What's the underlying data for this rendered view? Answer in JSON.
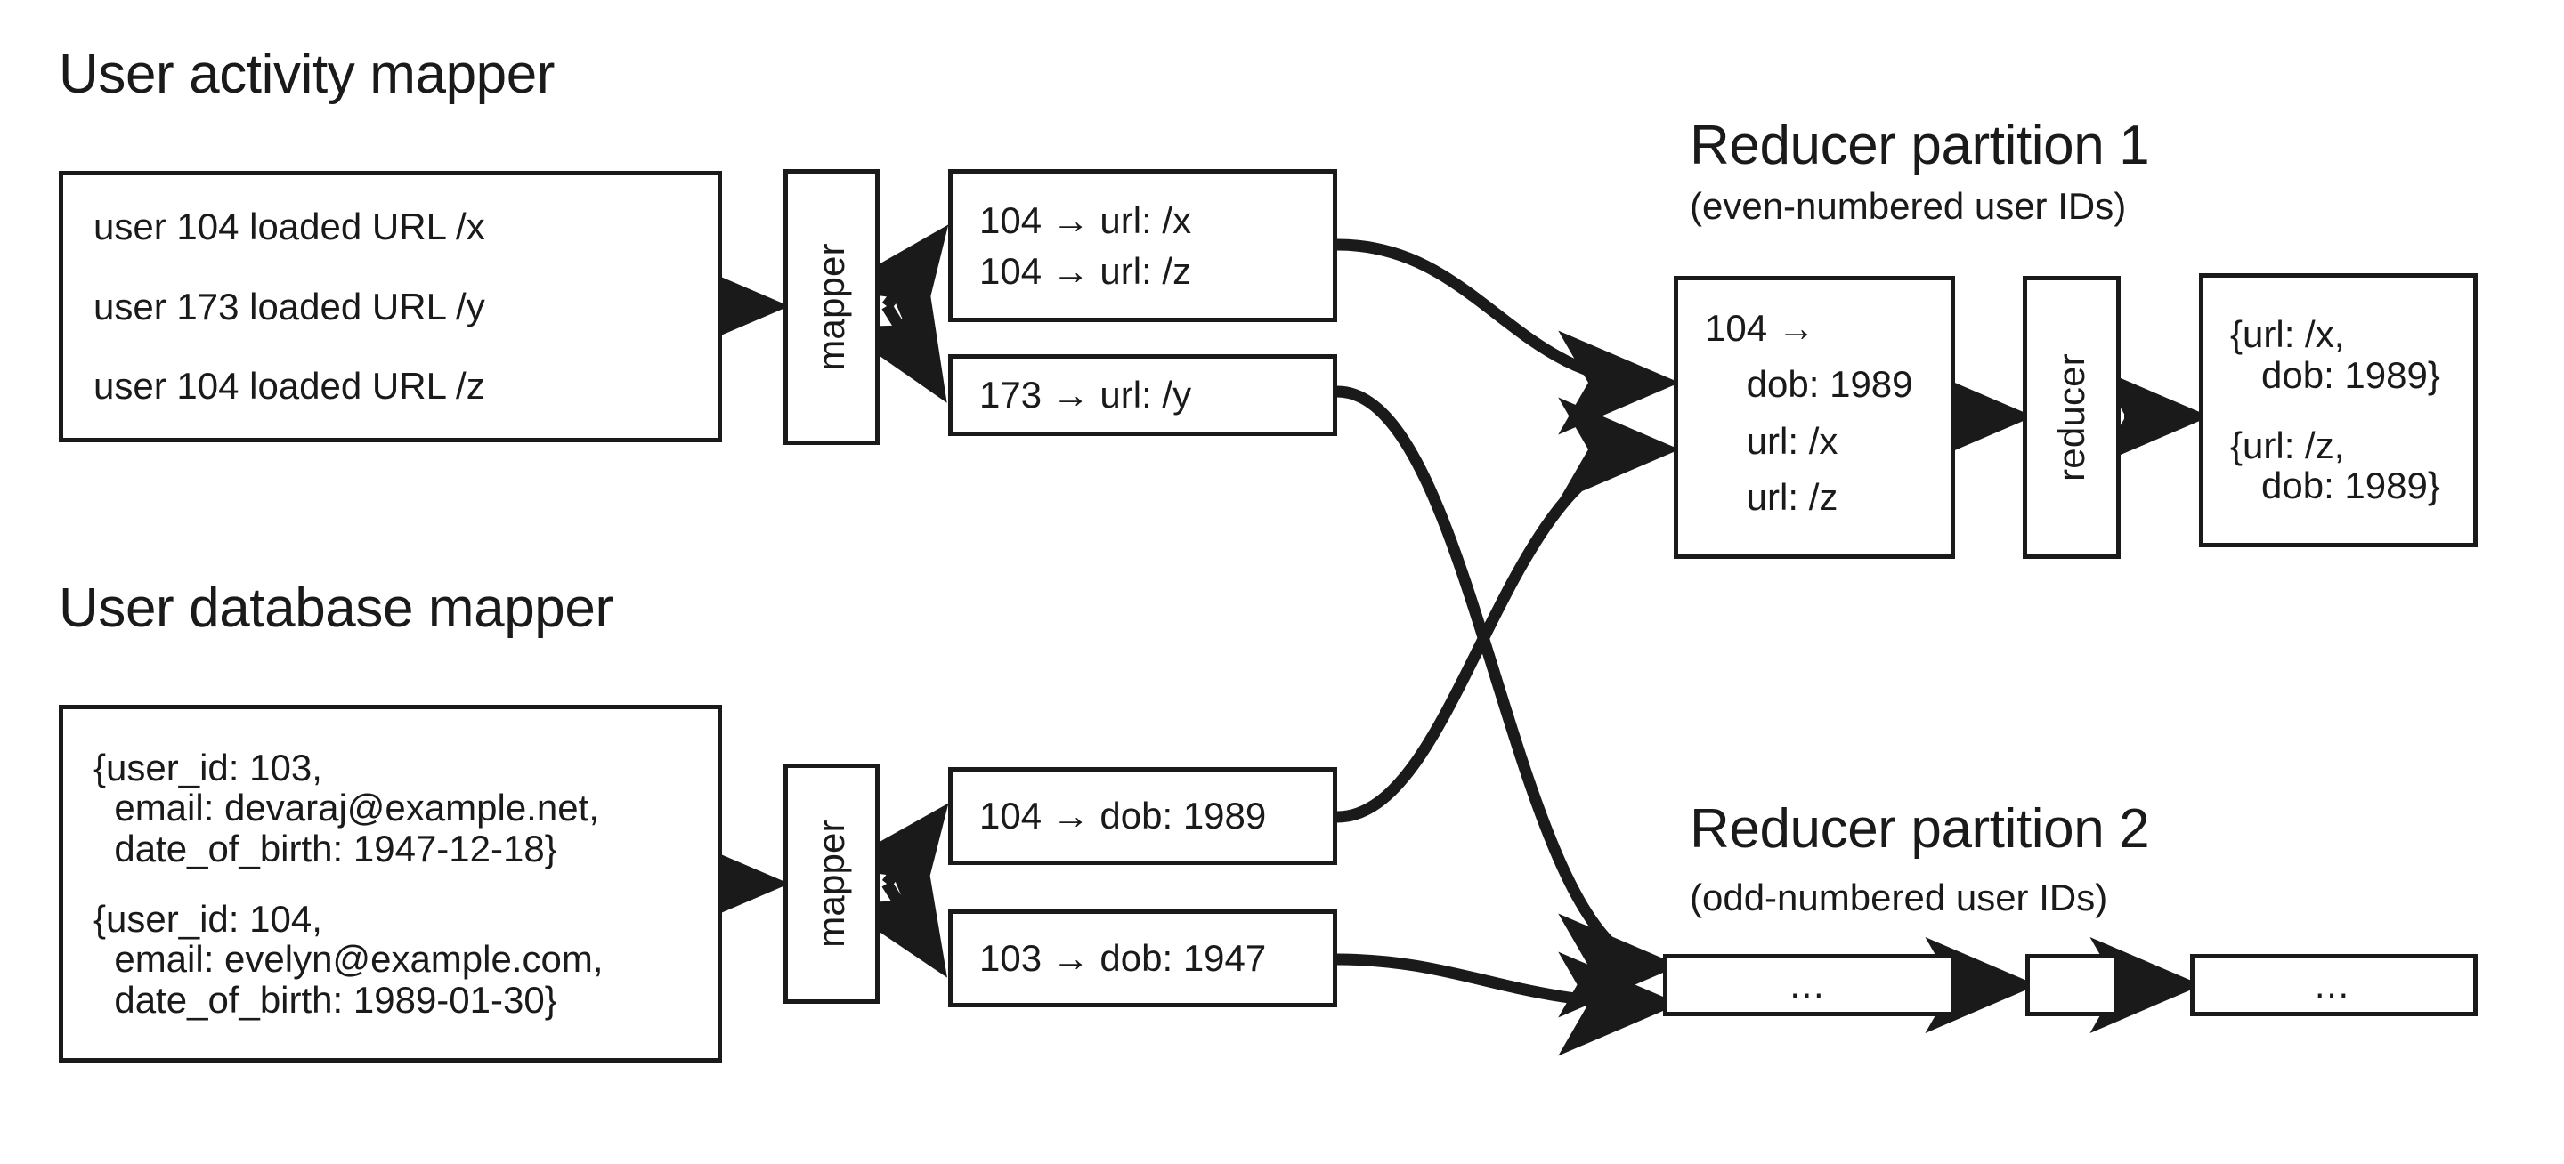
{
  "diagram": {
    "title_activity_mapper": "User activity mapper",
    "title_database_mapper": "User database mapper",
    "title_partition1": "Reducer partition 1",
    "subtitle_partition1": "(even-numbered user IDs)",
    "title_partition2": "Reducer partition 2",
    "subtitle_partition2": "(odd-numbered user IDs)"
  },
  "activity_input": {
    "lines": [
      "user 104 loaded URL /x",
      "user 173 loaded URL /y",
      "user 104 loaded URL /z"
    ]
  },
  "database_input": {
    "record1": [
      "{user_id: 103,",
      "  email: devaraj@example.net,",
      "  date_of_birth: 1947-12-18}"
    ],
    "record2": [
      "{user_id: 104,",
      "  email: evelyn@example.com,",
      "  date_of_birth: 1989-01-30}"
    ]
  },
  "mappers": {
    "activity_mapper_label": "mapper",
    "database_mapper_label": "mapper",
    "reducer_label": "reducer"
  },
  "activity_outputs": {
    "box1": [
      "104 → url: /x",
      "104 → url: /z"
    ],
    "box2": [
      "173 → url: /y"
    ]
  },
  "database_outputs": {
    "box1": [
      "104 → dob: 1989"
    ],
    "box2": [
      "103 → dob: 1947"
    ]
  },
  "partition1": {
    "reducer_input": [
      "104 →",
      "    dob: 1989",
      "    url: /x",
      "    url: /z"
    ],
    "reducer_output_group1": [
      "{url: /x,",
      "   dob: 1989}"
    ],
    "reducer_output_group2": [
      "{url: /z,",
      "   dob: 1989}"
    ]
  },
  "partition2": {
    "input_placeholder": "…",
    "reducer_placeholder": "",
    "output_placeholder": "…"
  },
  "colors": {
    "stroke": "#1a1a1a",
    "background": "#ffffff"
  }
}
